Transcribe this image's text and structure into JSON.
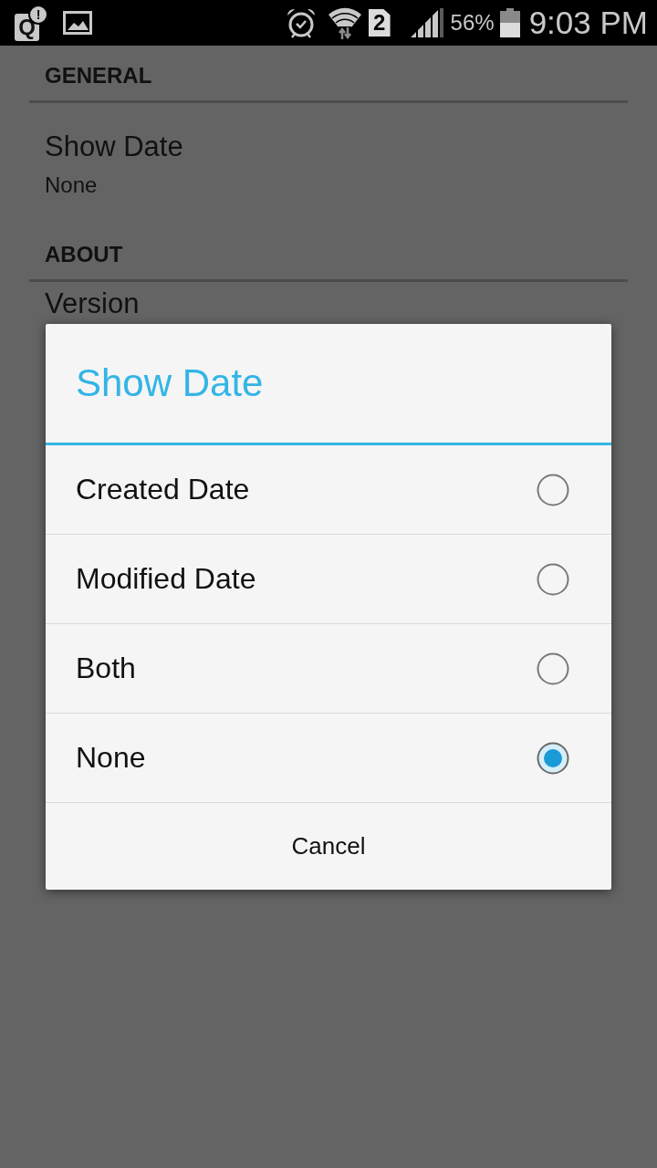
{
  "status_bar": {
    "notifications": [
      {
        "kind": "app",
        "letter": "Q",
        "badge": "!"
      },
      {
        "kind": "image"
      }
    ],
    "indicators": [
      {
        "kind": "alarm"
      },
      {
        "kind": "wifi"
      },
      {
        "kind": "sim",
        "label": "2"
      },
      {
        "kind": "signal"
      }
    ],
    "battery_text": "56%",
    "time": "9:03 PM"
  },
  "settings": {
    "sections": [
      {
        "header": "GENERAL",
        "items": [
          {
            "title": "Show Date",
            "summary": "None"
          }
        ]
      },
      {
        "header": "ABOUT",
        "items": [
          {
            "title": "Version"
          }
        ]
      }
    ]
  },
  "dialog": {
    "title": "Show Date",
    "options": [
      {
        "label": "Created Date",
        "selected": false
      },
      {
        "label": "Modified Date",
        "selected": false
      },
      {
        "label": "Both",
        "selected": false
      },
      {
        "label": "None",
        "selected": true
      }
    ],
    "buttons": [
      "Cancel"
    ]
  }
}
